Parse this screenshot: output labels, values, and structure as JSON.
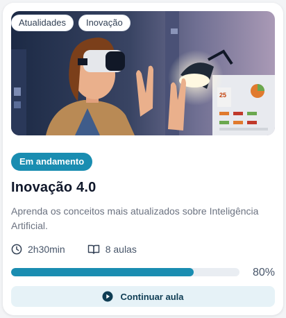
{
  "course": {
    "tags": [
      "Atualidades",
      "Inovação"
    ],
    "status": "Em andamento",
    "title": "Inovação 4.0",
    "description": "Aprenda os conceitos mais atualizados sobre Inteligência Artificial.",
    "duration": "2h30min",
    "lessons": "8 aulas",
    "progress_label": "80%",
    "progress_value": 0.8,
    "cta_label": "Continuar aula"
  },
  "icons": {
    "menu": "kebab-menu-icon",
    "duration": "clock-icon",
    "lessons": "book-icon",
    "cta": "play-icon"
  },
  "colors": {
    "accent": "#1a8db1",
    "progress_track": "#e9edf2",
    "cta_background": "#e6f2f7",
    "title": "#0f172a",
    "muted": "#6b7280"
  }
}
